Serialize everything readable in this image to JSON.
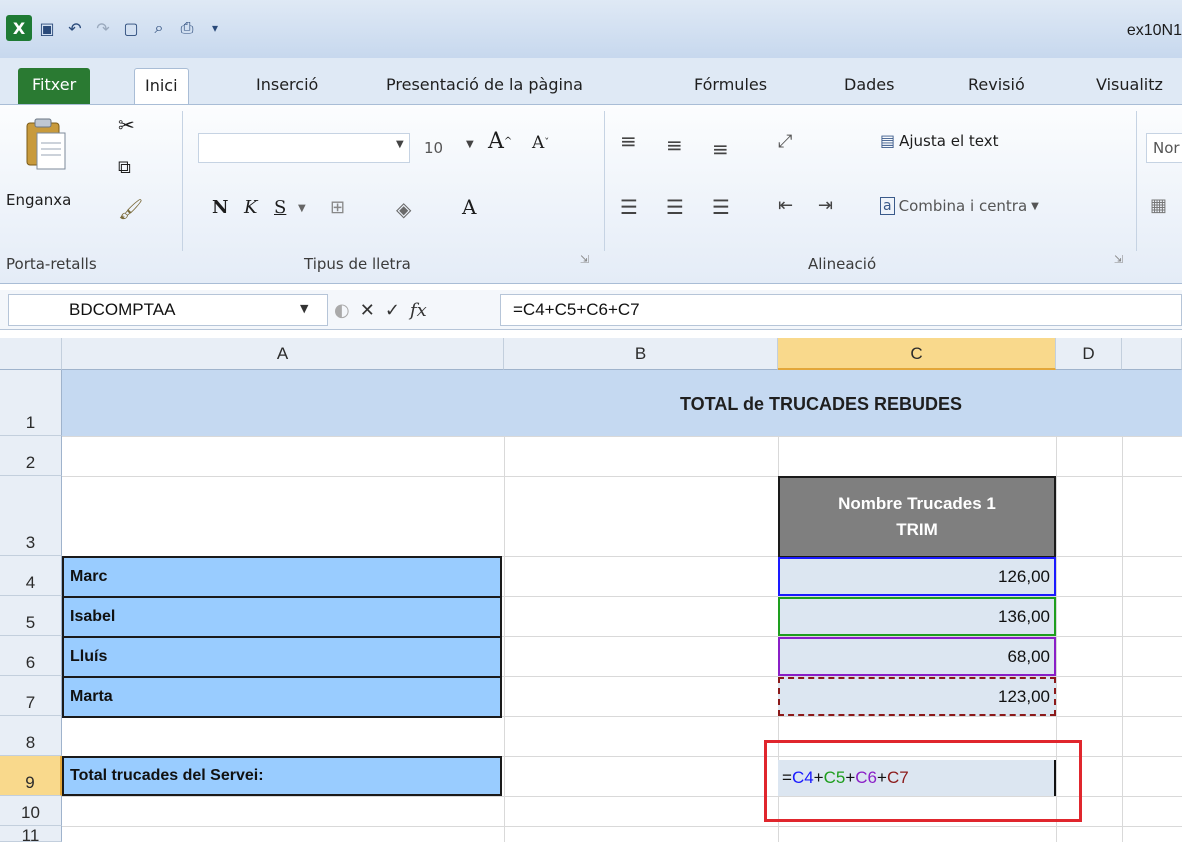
{
  "window": {
    "title": "ex10N1"
  },
  "quick_access": {
    "icons": [
      "excel-icon",
      "save-icon",
      "undo-icon",
      "redo-icon",
      "new-icon",
      "print-preview-icon",
      "print-icon",
      "customize-icon"
    ]
  },
  "tabs": [
    {
      "label": "Fitxer"
    },
    {
      "label": "Inici"
    },
    {
      "label": "Inserció"
    },
    {
      "label": "Presentació de la pàgina"
    },
    {
      "label": "Fórmules"
    },
    {
      "label": "Dades"
    },
    {
      "label": "Revisió"
    },
    {
      "label": "Visualitz"
    }
  ],
  "ribbon": {
    "clipboard": {
      "paste_label": "Enganxa",
      "group_label": "Porta-retalls"
    },
    "font": {
      "size": "10",
      "bold": "N",
      "italic": "K",
      "underline": "S",
      "group_label": "Tipus de lletra"
    },
    "alignment": {
      "wrap_label": "Ajusta el text",
      "merge_label": "Combina i centra",
      "group_label": "Alineació"
    },
    "number": {
      "format_label": "Nor"
    }
  },
  "formula_bar": {
    "name_box": "BDCOMPTAA",
    "formula": "=C4+C5+C6+C7",
    "fx": "fx"
  },
  "columns": [
    {
      "label": "A"
    },
    {
      "label": "B"
    },
    {
      "label": "C"
    },
    {
      "label": "D"
    }
  ],
  "rows": [
    "1",
    "2",
    "3",
    "4",
    "5",
    "6",
    "7",
    "8",
    "9",
    "10",
    "11"
  ],
  "sheet": {
    "title": "TOTAL de TRUCADES REBUDES",
    "header_line1": "Nombre Trucades 1",
    "header_line2": "TRIM",
    "names": [
      "Marc",
      "Isabel",
      "Lluís",
      "Marta"
    ],
    "values": [
      "126,00",
      "136,00",
      "68,00",
      "123,00"
    ],
    "total_label": "Total trucades del Servei:",
    "formula_tokens": [
      {
        "text": "=",
        "color": "#111111"
      },
      {
        "text": "C4",
        "color": "#1a1aff"
      },
      {
        "text": "+",
        "color": "#111111"
      },
      {
        "text": "C5",
        "color": "#1e9e1e"
      },
      {
        "text": "+",
        "color": "#111111"
      },
      {
        "text": "C6",
        "color": "#8a1fc7"
      },
      {
        "text": "+",
        "color": "#111111"
      },
      {
        "text": "C7",
        "color": "#8b1a1a"
      }
    ]
  },
  "colors": {
    "selected_header": "#f9d98c",
    "title_band": "#c5d9f1",
    "name_fill": "#99ccff",
    "value_fill": "#dce6f1",
    "highlight": "#e0262d"
  }
}
